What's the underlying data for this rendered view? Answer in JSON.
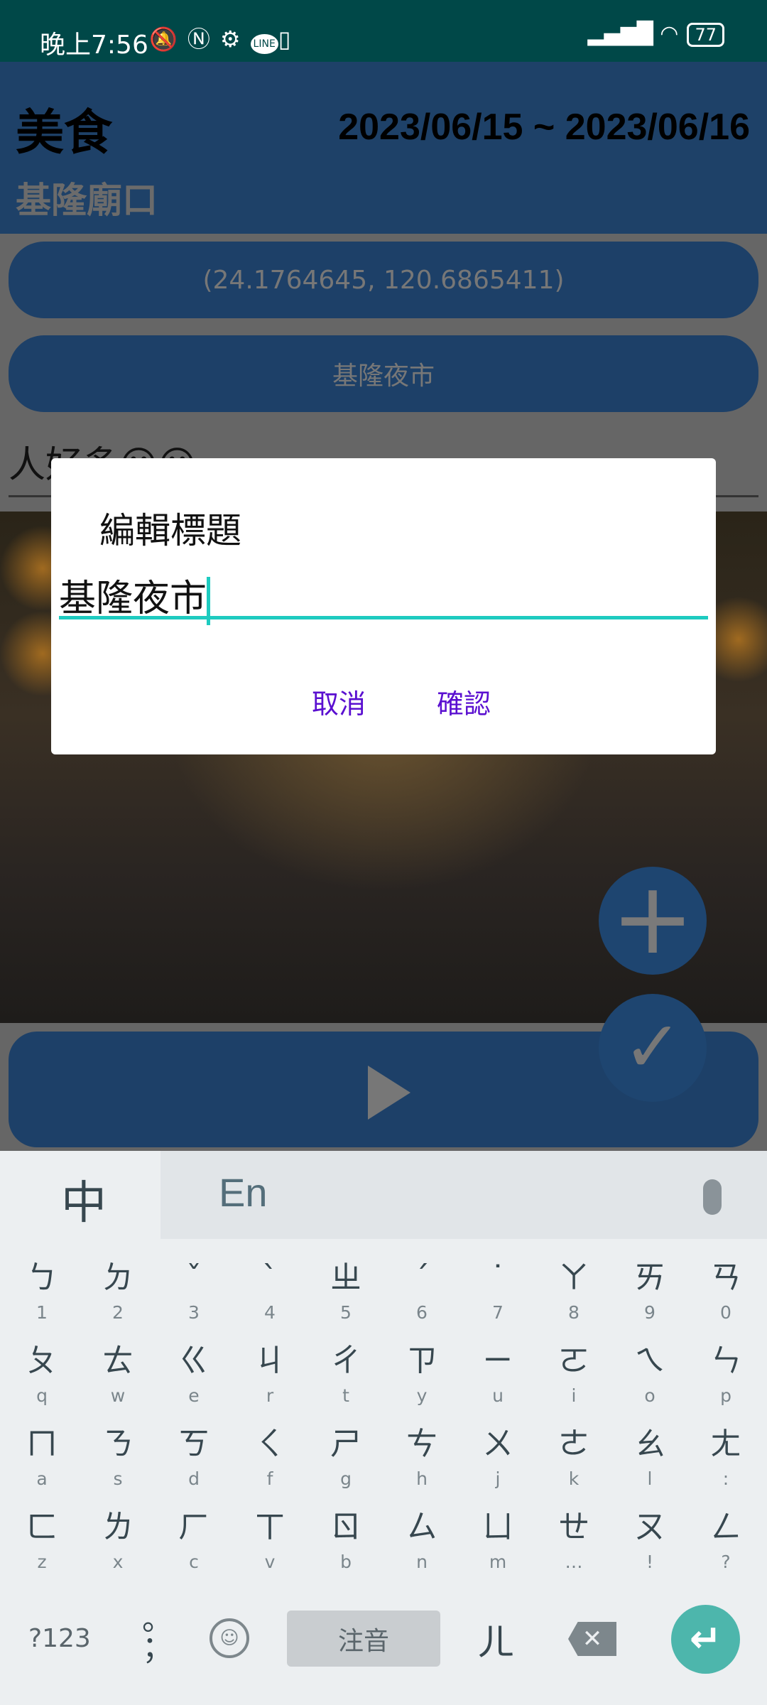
{
  "status": {
    "time": "晚上7:56",
    "icons": [
      "mute-icon",
      "nfc-icon",
      "settings-icon",
      "line-icon",
      "sim-icon"
    ],
    "line_label": "LINE",
    "battery": "77"
  },
  "header": {
    "title": "美食",
    "date_range": "2023/06/15 ~ 2023/06/16",
    "subtitle": "基隆廟口"
  },
  "main": {
    "coords_button": "(24.1764645, 120.6865411)",
    "place_button": "基隆夜市",
    "note": "人好多😀😀"
  },
  "dialog": {
    "title": "編輯標題",
    "input_value": "基隆夜市",
    "cancel": "取消",
    "confirm": "確認"
  },
  "keyboard": {
    "lang_zh": "中",
    "lang_en": "En",
    "rows": [
      [
        [
          "ㄅ",
          "1"
        ],
        [
          "ㄉ",
          "2"
        ],
        [
          "ˇ",
          "3"
        ],
        [
          "ˋ",
          "4"
        ],
        [
          "ㄓ",
          "5"
        ],
        [
          "ˊ",
          "6"
        ],
        [
          "˙",
          "7"
        ],
        [
          "ㄚ",
          "8"
        ],
        [
          "ㄞ",
          "9"
        ],
        [
          "ㄢ",
          "0"
        ]
      ],
      [
        [
          "ㄆ",
          "q"
        ],
        [
          "ㄊ",
          "w"
        ],
        [
          "ㄍ",
          "e"
        ],
        [
          "ㄐ",
          "r"
        ],
        [
          "ㄔ",
          "t"
        ],
        [
          "ㄗ",
          "y"
        ],
        [
          "ㄧ",
          "u"
        ],
        [
          "ㄛ",
          "i"
        ],
        [
          "ㄟ",
          "o"
        ],
        [
          "ㄣ",
          "p"
        ]
      ],
      [
        [
          "ㄇ",
          "a"
        ],
        [
          "ㄋ",
          "s"
        ],
        [
          "ㄎ",
          "d"
        ],
        [
          "ㄑ",
          "f"
        ],
        [
          "ㄕ",
          "g"
        ],
        [
          "ㄘ",
          "h"
        ],
        [
          "ㄨ",
          "j"
        ],
        [
          "ㄜ",
          "k"
        ],
        [
          "ㄠ",
          "l"
        ],
        [
          "ㄤ",
          ":"
        ]
      ],
      [
        [
          "ㄈ",
          "z"
        ],
        [
          "ㄌ",
          "x"
        ],
        [
          "ㄏ",
          "c"
        ],
        [
          "ㄒ",
          "v"
        ],
        [
          "ㄖ",
          "b"
        ],
        [
          "ㄙ",
          "n"
        ],
        [
          "ㄩ",
          "m"
        ],
        [
          "ㄝ",
          "…"
        ],
        [
          "ㄡ",
          "!"
        ],
        [
          "ㄥ",
          "?"
        ]
      ]
    ],
    "symbols": "?123",
    "punct_top": "。",
    "punct_bottom": "；",
    "emoji": "☺",
    "space": "注音",
    "er": "ㄦ",
    "delete": "✕",
    "enter": "↵"
  }
}
